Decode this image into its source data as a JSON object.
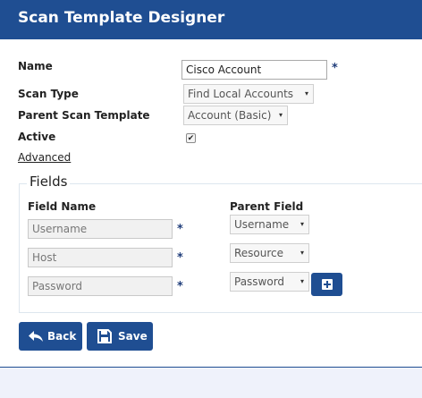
{
  "header": {
    "title": "Scan Template Designer"
  },
  "form": {
    "name_label": "Name",
    "name_value": "Cisco Account",
    "required_mark": "*",
    "scan_type_label": "Scan Type",
    "scan_type_value": "Find Local Accounts",
    "parent_template_label": "Parent Scan Template",
    "parent_template_value": "Account (Basic)",
    "active_label": "Active",
    "active_checked": true,
    "advanced_link": "Advanced"
  },
  "fields": {
    "legend": "Fields",
    "col_field_name": "Field Name",
    "col_parent_field": "Parent Field",
    "rows": [
      {
        "field_name": "Username",
        "parent_field": "Username"
      },
      {
        "field_name": "Host",
        "parent_field": "Resource"
      },
      {
        "field_name": "Password",
        "parent_field": "Password"
      }
    ]
  },
  "actions": {
    "back_label": "Back",
    "save_label": "Save"
  },
  "icons": {
    "caret": "▾",
    "checkmark": "✔"
  },
  "colors": {
    "primary": "#1f4e92",
    "required": "#1f3d7a",
    "footer": "#eff2fb"
  }
}
